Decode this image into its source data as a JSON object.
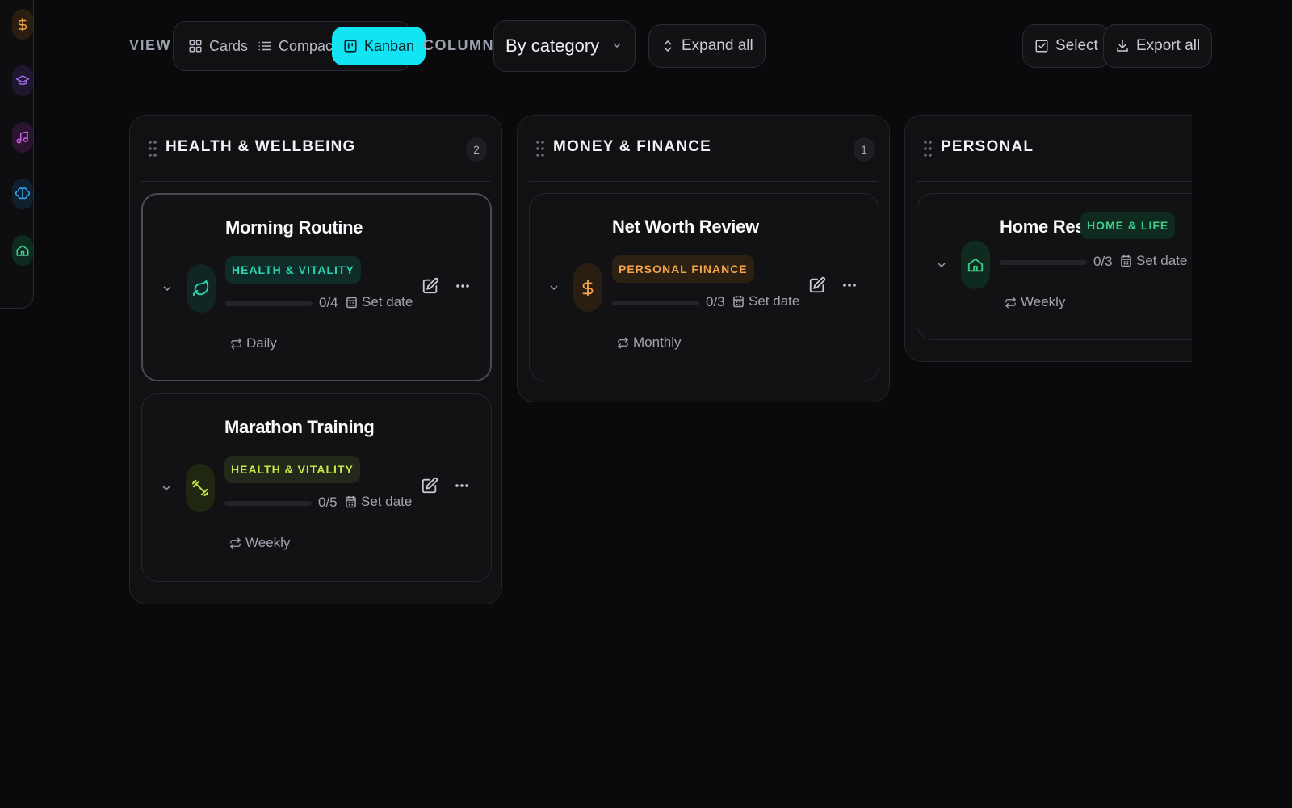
{
  "toolbar": {
    "view_label": "VIEW",
    "view_modes": [
      {
        "label": "Cards",
        "icon": "grid-icon",
        "active": false
      },
      {
        "label": "Compact",
        "icon": "list-icon",
        "active": false
      },
      {
        "label": "Kanban",
        "icon": "kanban-icon",
        "active": true
      }
    ],
    "columns_label": "COLUMNS",
    "columns_select": "By category",
    "expand_all": "Expand all",
    "select": "Select",
    "export_all": "Export all"
  },
  "rail": {
    "icons": [
      "dollar-icon",
      "graduation-cap-icon",
      "music-icon",
      "brain-icon",
      "home-icon"
    ]
  },
  "colors": {
    "accent": "#12e4f4",
    "health": "#2bd4b0",
    "fitness": "#c7e84b",
    "finance": "#f5a54a",
    "home": "#3ecf8e",
    "education": "#a06cf5",
    "music": "#d35cf0",
    "brain": "#3aa8f0"
  },
  "columns": [
    {
      "title": "HEALTH & WELLBEING",
      "count": "2",
      "cards": [
        {
          "title": "Morning Routine",
          "tag": "HEALTH & VITALITY",
          "icon": "leaf-icon",
          "progress_text": "0/4",
          "progress": 0,
          "date": "Set date",
          "recurrence": "Daily"
        },
        {
          "title": "Marathon Training",
          "tag": "HEALTH & VITALITY",
          "icon": "dumbbell-icon",
          "progress_text": "0/5",
          "progress": 0,
          "date": "Set date",
          "recurrence": "Weekly"
        }
      ]
    },
    {
      "title": "MONEY & FINANCE",
      "count": "1",
      "cards": [
        {
          "title": "Net Worth Review",
          "tag": "PERSONAL FINANCE",
          "icon": "dollar-icon",
          "progress_text": "0/3",
          "progress": 0,
          "date": "Set date",
          "recurrence": "Monthly"
        }
      ]
    },
    {
      "title": "PERSONAL",
      "count": "",
      "cards": [
        {
          "title": "Home Reset",
          "tag": "HOME & LIFE",
          "icon": "home-icon",
          "progress_text": "0/3",
          "progress": 0,
          "date": "Set date",
          "recurrence": "Weekly"
        }
      ]
    }
  ]
}
